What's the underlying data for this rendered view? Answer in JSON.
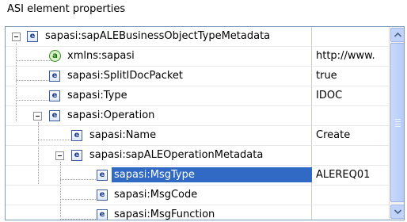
{
  "panel_title": "ASI element properties",
  "tree": [
    {
      "name": "sapasi:sapALEBusinessObjectTypeMetadata",
      "value": "",
      "icon": "element-icon",
      "icon_glyph": "e"
    },
    {
      "name": "xmlns:sapasi",
      "value": "http://www.",
      "icon": "attribute-icon",
      "icon_glyph": "a"
    },
    {
      "name": "sapasi:SplitIDocPacket",
      "value": "true",
      "icon": "element-icon",
      "icon_glyph": "e"
    },
    {
      "name": "sapasi:Type",
      "value": "IDOC",
      "icon": "element-icon",
      "icon_glyph": "e"
    },
    {
      "name": "sapasi:Operation",
      "value": "",
      "icon": "element-icon",
      "icon_glyph": "e"
    },
    {
      "name": "sapasi:Name",
      "value": "Create",
      "icon": "element-icon",
      "icon_glyph": "e"
    },
    {
      "name": "sapasi:sapALEOperationMetadata",
      "value": "",
      "icon": "element-icon",
      "icon_glyph": "e"
    },
    {
      "name": "sapasi:MsgType",
      "value": "ALEREQ01",
      "icon": "element-icon",
      "icon_glyph": "e",
      "selected": true
    },
    {
      "name": "sapasi:MsgCode",
      "value": "",
      "icon": "element-icon",
      "icon_glyph": "e"
    },
    {
      "name": "sapasi:MsgFunction",
      "value": "",
      "icon": "element-icon",
      "icon_glyph": "e"
    }
  ],
  "colors": {
    "selection": "#316ac5",
    "border": "#7f9db9"
  }
}
